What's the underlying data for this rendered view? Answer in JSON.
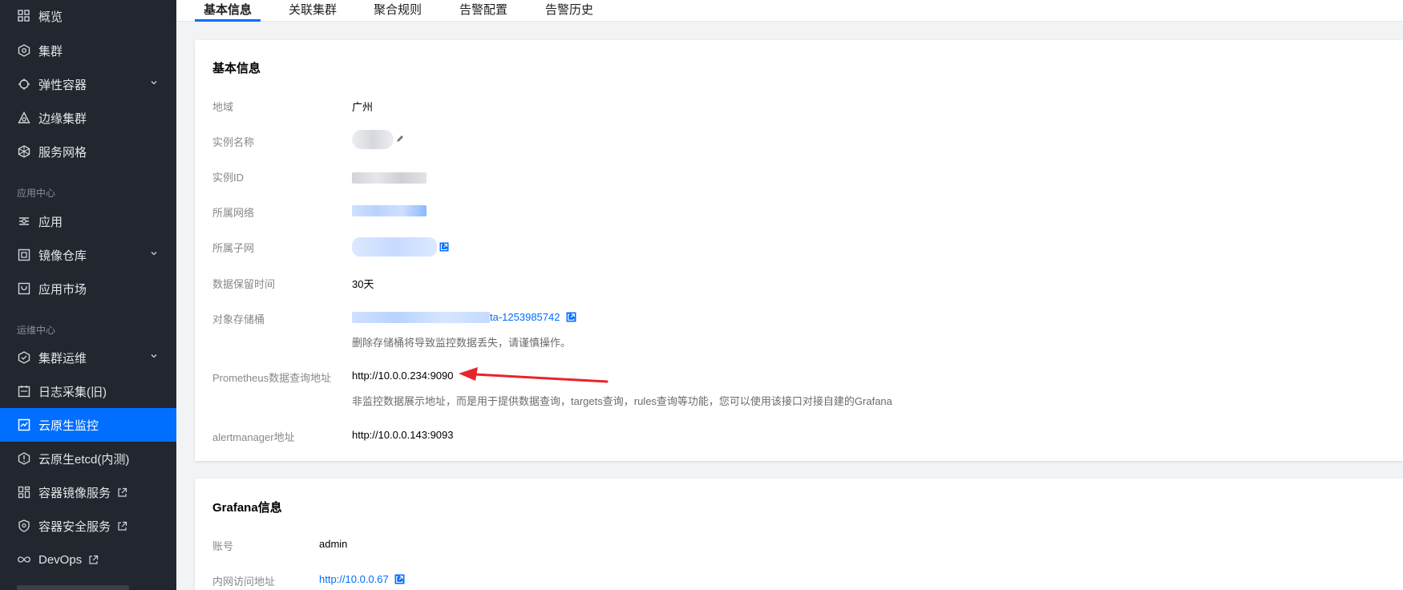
{
  "sidebar": {
    "items": [
      {
        "label": "概览",
        "icon": "grid-icon"
      },
      {
        "label": "集群",
        "icon": "cluster-icon"
      },
      {
        "label": "弹性容器",
        "icon": "elastic-container-icon"
      },
      {
        "label": "边缘集群",
        "icon": "edge-cluster-icon"
      },
      {
        "label": "服务网格",
        "icon": "service-mesh-icon"
      },
      {
        "label": "应用",
        "icon": "app-icon"
      },
      {
        "label": "镜像仓库",
        "icon": "image-registry-icon"
      },
      {
        "label": "应用市场",
        "icon": "app-market-icon"
      },
      {
        "label": "集群运维",
        "icon": "cluster-ops-icon"
      },
      {
        "label": "日志采集(旧)",
        "icon": "log-icon"
      },
      {
        "label": "云原生监控",
        "icon": "monitor-icon"
      },
      {
        "label": "云原生etcd(内测)",
        "icon": "etcd-icon"
      },
      {
        "label": "容器镜像服务",
        "icon": "container-image-icon"
      },
      {
        "label": "容器安全服务",
        "icon": "shield-icon"
      },
      {
        "label": "DevOps",
        "icon": "infinity-icon"
      }
    ],
    "groups": {
      "app_center": "应用中心",
      "ops_center": "运维中心"
    }
  },
  "tabs": [
    "基本信息",
    "关联集群",
    "聚合规则",
    "告警配置",
    "告警历史"
  ],
  "basic": {
    "title": "基本信息",
    "region_label": "地域",
    "region_value": "广州",
    "name_label": "实例名称",
    "id_label": "实例ID",
    "vpc_label": "所属网络",
    "subnet_label": "所属子网",
    "retention_label": "数据保留时间",
    "retention_value": "30天",
    "bucket_label": "对象存储桶",
    "bucket_value": "ta-1253985742",
    "bucket_hint": "删除存储桶将导致监控数据丢失，请谨慎操作。",
    "prom_label": "Prometheus数据查询地址",
    "prom_value": "http://10.0.0.234:9090",
    "prom_hint": "非监控数据展示地址，而是用于提供数据查询，targets查询，rules查询等功能，您可以使用该接口对接自建的Grafana",
    "alert_label": "alertmanager地址",
    "alert_value": "http://10.0.0.143:9093"
  },
  "grafana": {
    "title": "Grafana信息",
    "account_label": "账号",
    "account_value": "admin",
    "intranet_label": "内网访问地址",
    "intranet_value": "http://10.0.0.67"
  },
  "colors": {
    "accent": "#006eff",
    "sidebar_bg": "#22262e",
    "arrow": "#e8242a"
  }
}
